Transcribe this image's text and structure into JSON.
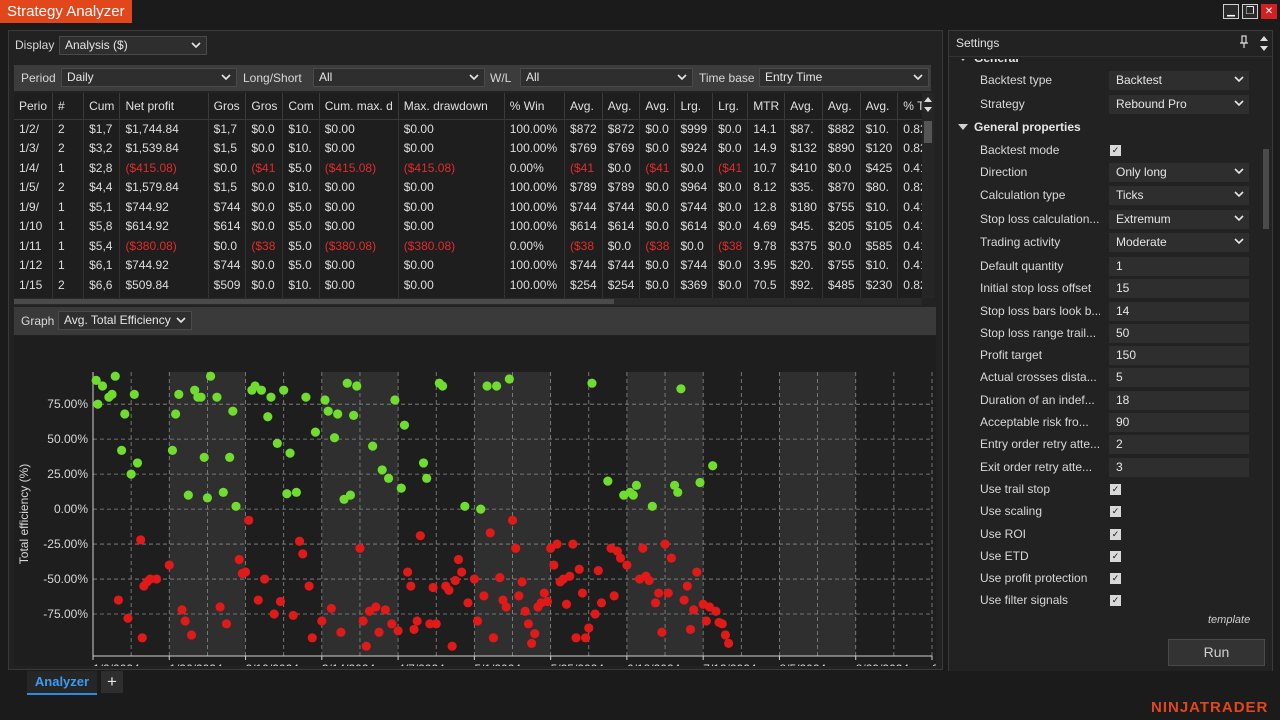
{
  "window": {
    "title": "Strategy Analyzer",
    "minimize": "▁",
    "restore": "❐",
    "close": "✕"
  },
  "display": {
    "label": "Display",
    "value": "Analysis ($)"
  },
  "filters": {
    "period_label": "Period",
    "period_value": "Daily",
    "longshort_label": "Long/Short",
    "longshort_value": "All",
    "wl_label": "W/L",
    "wl_value": "All",
    "timebase_label": "Time base",
    "timebase_value": "Entry Time"
  },
  "table": {
    "columns": [
      "Perio",
      "#",
      "Cum",
      "Net profit",
      "Gros",
      "Gros",
      "Com",
      "Cum. max. d",
      "Max. drawdown",
      "% Win",
      "Avg.",
      "Avg.",
      "Avg.",
      "Lrg. ",
      "Lrg.",
      "MTR",
      "Avg.",
      "Avg.",
      "Avg.",
      "% Tr"
    ],
    "rows": [
      [
        "1/2/",
        "2",
        "$1,7",
        "$1,744.84",
        "$1,7",
        "$0.0",
        "$10.",
        "$0.00",
        "$0.00",
        "100.00%",
        "$872",
        "$872",
        "$0.0",
        "$999",
        "$0.0",
        "14.1",
        "$87.",
        "$882",
        "$10.",
        "0.82"
      ],
      [
        "1/3/",
        "2",
        "$3,2",
        "$1,539.84",
        "$1,5",
        "$0.0",
        "$10.",
        "$0.00",
        "$0.00",
        "100.00%",
        "$769",
        "$769",
        "$0.0",
        "$924",
        "$0.0",
        "14.9",
        "$132",
        "$890",
        "$120",
        "0.82"
      ],
      [
        "1/4/",
        "1",
        "$2,8",
        "($415.08)",
        "$0.0",
        "($41",
        "$5.0",
        "($415.08)",
        "($415.08)",
        "0.00%",
        "($41",
        "$0.0",
        "($41",
        "$0.0",
        "($41",
        "10.7",
        "$410",
        "$0.0",
        "$425",
        "0.41"
      ],
      [
        "1/5/",
        "2",
        "$4,4",
        "$1,579.84",
        "$1,5",
        "$0.0",
        "$10.",
        "$0.00",
        "$0.00",
        "100.00%",
        "$789",
        "$789",
        "$0.0",
        "$964",
        "$0.0",
        "8.12",
        "$35.",
        "$870",
        "$80.",
        "0.82"
      ],
      [
        "1/9/",
        "1",
        "$5,1",
        "$744.92",
        "$744",
        "$0.0",
        "$5.0",
        "$0.00",
        "$0.00",
        "100.00%",
        "$744",
        "$744",
        "$0.0",
        "$744",
        "$0.0",
        "12.8",
        "$180",
        "$755",
        "$10.",
        "0.41"
      ],
      [
        "1/10",
        "1",
        "$5,8",
        "$614.92",
        "$614",
        "$0.0",
        "$5.0",
        "$0.00",
        "$0.00",
        "100.00%",
        "$614",
        "$614",
        "$0.0",
        "$614",
        "$0.0",
        "4.69",
        "$45.",
        "$205",
        "$105",
        "0.41"
      ],
      [
        "1/11",
        "1",
        "$5,4",
        "($380.08)",
        "$0.0",
        "($38",
        "$5.0",
        "($380.08)",
        "($380.08)",
        "0.00%",
        "($38",
        "$0.0",
        "($38",
        "$0.0",
        "($38",
        "9.78",
        "$375",
        "$0.0",
        "$585",
        "0.41"
      ],
      [
        "1/12",
        "1",
        "$6,1",
        "$744.92",
        "$744",
        "$0.0",
        "$5.0",
        "$0.00",
        "$0.00",
        "100.00%",
        "$744",
        "$744",
        "$0.0",
        "$744",
        "$0.0",
        "3.95",
        "$20.",
        "$755",
        "$10.",
        "0.41"
      ],
      [
        "1/15",
        "2",
        "$6,6",
        "$509.84",
        "$509",
        "$0.0",
        "$10.",
        "$0.00",
        "$0.00",
        "100.00%",
        "$254",
        "$254",
        "$0.0",
        "$369",
        "$0.0",
        "70.5",
        "$92.",
        "$485",
        "$230",
        "0.82"
      ],
      [
        "1/16",
        "2",
        "$7,4",
        "$744.92",
        "$744",
        "$0.0",
        "$5.0",
        "$0.00",
        "$0.00",
        "100.00%",
        "$744",
        "$744",
        "$0.0",
        "$744",
        "$0.0",
        "7.09",
        "$20.",
        "$755",
        "$10.",
        "0.82"
      ]
    ]
  },
  "graph": {
    "label": "Graph",
    "value": "Avg. Total Efficiency"
  },
  "chart_data": {
    "type": "scatter",
    "xlabel": "Date",
    "ylabel": "Total efficiency (%)",
    "ylim": [
      -105,
      98
    ],
    "y_ticks": [
      75,
      50,
      25,
      0,
      -25,
      -50,
      -75
    ],
    "y_tick_labels": [
      "75.00%",
      "50.00%",
      "25.00%",
      "0.00%",
      "-25.00%",
      "-50.00%",
      "-75.00%"
    ],
    "x_tick_labels": [
      "1/2/2024",
      "1/26/2024",
      "2/19/2024",
      "3/14/2024",
      "4/7/2024",
      "5/1/2024",
      "5/25/2024",
      "6/18/2024",
      "7/12/2024",
      "8/5/2024",
      "8/29/2024",
      "9/22/2024"
    ],
    "xlim": [
      0,
      264
    ],
    "shaded_bands": [
      [
        24,
        48
      ],
      [
        72,
        96
      ],
      [
        120,
        144
      ],
      [
        168,
        192
      ],
      [
        216,
        240
      ]
    ],
    "grid": true,
    "positive_color": "#6fdc2f",
    "negative_color": "#e01919",
    "points": [
      [
        1,
        92
      ],
      [
        1.5,
        75
      ],
      [
        3,
        88
      ],
      [
        5,
        80
      ],
      [
        6,
        82
      ],
      [
        7,
        95
      ],
      [
        8,
        -65
      ],
      [
        9,
        42
      ],
      [
        10,
        68
      ],
      [
        11,
        -78
      ],
      [
        12,
        25
      ],
      [
        13,
        82
      ],
      [
        14,
        33
      ],
      [
        15,
        -22
      ],
      [
        15.5,
        -92
      ],
      [
        16,
        -55
      ],
      [
        17,
        -52
      ],
      [
        18,
        -50
      ],
      [
        20,
        -50
      ],
      [
        24,
        -40
      ],
      [
        25,
        42
      ],
      [
        26,
        68
      ],
      [
        27,
        82
      ],
      [
        28,
        -72
      ],
      [
        29,
        -80
      ],
      [
        30,
        10
      ],
      [
        31,
        -90
      ],
      [
        32,
        85
      ],
      [
        33,
        80
      ],
      [
        34,
        80
      ],
      [
        35,
        37
      ],
      [
        36,
        8
      ],
      [
        37,
        95
      ],
      [
        39,
        80
      ],
      [
        40,
        -70
      ],
      [
        41,
        12
      ],
      [
        42,
        -82
      ],
      [
        43,
        37
      ],
      [
        44,
        70
      ],
      [
        45,
        2
      ],
      [
        46,
        -36
      ],
      [
        47,
        -46
      ],
      [
        48,
        -45
      ],
      [
        49,
        -8
      ],
      [
        50,
        85
      ],
      [
        51,
        88
      ],
      [
        52,
        -65
      ],
      [
        53,
        85
      ],
      [
        54,
        -50
      ],
      [
        55,
        66
      ],
      [
        56,
        80
      ],
      [
        57,
        -75
      ],
      [
        58,
        47
      ],
      [
        59,
        -66
      ],
      [
        60,
        85
      ],
      [
        61,
        11
      ],
      [
        62,
        40
      ],
      [
        63,
        -76
      ],
      [
        64,
        12
      ],
      [
        65,
        -23
      ],
      [
        66,
        -32
      ],
      [
        67,
        80
      ],
      [
        68,
        -55
      ],
      [
        69,
        -92
      ],
      [
        70,
        55
      ],
      [
        72,
        -80
      ],
      [
        73,
        78
      ],
      [
        74,
        70
      ],
      [
        75,
        -71
      ],
      [
        76,
        51
      ],
      [
        77,
        68
      ],
      [
        78,
        -88
      ],
      [
        79,
        7
      ],
      [
        80,
        90
      ],
      [
        81,
        10
      ],
      [
        82,
        67
      ],
      [
        83,
        88
      ],
      [
        84,
        -28
      ],
      [
        85,
        -80
      ],
      [
        86,
        -98
      ],
      [
        87,
        -73
      ],
      [
        88,
        45
      ],
      [
        89,
        -70
      ],
      [
        90,
        -88
      ],
      [
        91,
        28
      ],
      [
        92,
        -72
      ],
      [
        93,
        22
      ],
      [
        94,
        -82
      ],
      [
        95,
        78
      ],
      [
        96,
        -87
      ],
      [
        97,
        15
      ],
      [
        98,
        60
      ],
      [
        99,
        -45
      ],
      [
        100,
        -55
      ],
      [
        101,
        -86
      ],
      [
        102,
        -80
      ],
      [
        103,
        -19
      ],
      [
        104,
        33
      ],
      [
        105,
        22
      ],
      [
        106,
        -82
      ],
      [
        107,
        -56
      ],
      [
        108,
        -82
      ],
      [
        109,
        90
      ],
      [
        110,
        88
      ],
      [
        111,
        -55
      ],
      [
        112,
        -58
      ],
      [
        113,
        -98
      ],
      [
        114,
        -51
      ],
      [
        115,
        -36
      ],
      [
        116,
        -45
      ],
      [
        117,
        2
      ],
      [
        118,
        -67
      ],
      [
        120,
        -50
      ],
      [
        121,
        -80
      ],
      [
        122,
        0
      ],
      [
        123,
        -62
      ],
      [
        124,
        88
      ],
      [
        125,
        -17
      ],
      [
        126,
        -92
      ],
      [
        127,
        88
      ],
      [
        128,
        -49
      ],
      [
        129,
        -65
      ],
      [
        130,
        -70
      ],
      [
        131,
        93
      ],
      [
        132,
        -8
      ],
      [
        133,
        -28
      ],
      [
        134,
        -62
      ],
      [
        135,
        -52
      ],
      [
        136,
        -73
      ],
      [
        137,
        -82
      ],
      [
        138,
        -96
      ],
      [
        139,
        -89
      ],
      [
        140,
        -70
      ],
      [
        141,
        -67
      ],
      [
        142,
        -60
      ],
      [
        143,
        -66
      ],
      [
        144,
        -28
      ],
      [
        145,
        -40
      ],
      [
        146,
        -25
      ],
      [
        147,
        -52
      ],
      [
        148,
        -50
      ],
      [
        149,
        -68
      ],
      [
        150,
        -48
      ],
      [
        151,
        -25
      ],
      [
        152,
        -92
      ],
      [
        153,
        -43
      ],
      [
        154,
        -60
      ],
      [
        155,
        -92
      ],
      [
        156,
        -85
      ],
      [
        157,
        90
      ],
      [
        158,
        -75
      ],
      [
        159,
        -44
      ],
      [
        160,
        -67
      ],
      [
        162,
        20
      ],
      [
        163,
        -28
      ],
      [
        164,
        -62
      ],
      [
        165,
        -30
      ],
      [
        166,
        -35
      ],
      [
        167,
        10
      ],
      [
        168,
        -40
      ],
      [
        169,
        12
      ],
      [
        170,
        10
      ],
      [
        171,
        17
      ],
      [
        172,
        -50
      ],
      [
        173,
        -28
      ],
      [
        174,
        -48
      ],
      [
        175,
        -51
      ],
      [
        176,
        2
      ],
      [
        177,
        -67
      ],
      [
        178,
        -60
      ],
      [
        179,
        -88
      ],
      [
        180,
        -25
      ],
      [
        181,
        -60
      ],
      [
        182,
        -35
      ],
      [
        183,
        17
      ],
      [
        184,
        12
      ],
      [
        185,
        86
      ],
      [
        186,
        -65
      ],
      [
        187,
        -55
      ],
      [
        188,
        -86
      ],
      [
        189,
        -72
      ],
      [
        190,
        -45
      ],
      [
        191,
        19
      ],
      [
        192,
        -68
      ],
      [
        193,
        -80
      ],
      [
        194,
        -70
      ],
      [
        195,
        31
      ],
      [
        196,
        -73
      ],
      [
        197,
        -81
      ],
      [
        198,
        -82
      ],
      [
        199,
        -90
      ],
      [
        200,
        -96
      ]
    ]
  },
  "settings": {
    "title": "Settings",
    "pin": "📌",
    "rows": [
      {
        "type": "cat",
        "name": "General",
        "top": -12
      },
      {
        "type": "combo",
        "name": "Backtest type",
        "value": "Backtest"
      },
      {
        "type": "combo",
        "name": "Strategy",
        "value": "Rebound Pro"
      },
      {
        "type": "cat",
        "name": "General properties"
      },
      {
        "type": "check",
        "name": "Backtest mode"
      },
      {
        "type": "combo",
        "name": "Direction",
        "value": "Only long"
      },
      {
        "type": "combo",
        "name": "Calculation type",
        "value": "Ticks"
      },
      {
        "type": "combo",
        "name": "Stop loss calculation...",
        "value": "Extremum"
      },
      {
        "type": "combo",
        "name": "Trading activity",
        "value": "Moderate"
      },
      {
        "type": "text",
        "name": "Default quantity",
        "value": "1"
      },
      {
        "type": "text",
        "name": "Initial stop loss offset",
        "value": "15"
      },
      {
        "type": "text",
        "name": "Stop loss bars look b...",
        "value": "14"
      },
      {
        "type": "text",
        "name": "Stop loss range trail...",
        "value": "50"
      },
      {
        "type": "text",
        "name": "Profit target",
        "value": "150"
      },
      {
        "type": "text",
        "name": "Actual crosses dista...",
        "value": "5"
      },
      {
        "type": "text",
        "name": "Duration of an indef...",
        "value": "18"
      },
      {
        "type": "text",
        "name": "Acceptable risk fro...",
        "value": "90"
      },
      {
        "type": "text",
        "name": "Entry order retry atte...",
        "value": "2"
      },
      {
        "type": "text",
        "name": "Exit order retry atte...",
        "value": "3"
      },
      {
        "type": "check",
        "name": "Use trail stop"
      },
      {
        "type": "check",
        "name": "Use scaling"
      },
      {
        "type": "check",
        "name": "Use ROI"
      },
      {
        "type": "check",
        "name": "Use ETD"
      },
      {
        "type": "check",
        "name": "Use profit protection"
      },
      {
        "type": "check",
        "name": "Use filter signals"
      }
    ],
    "template_label": "template",
    "run_label": "Run"
  },
  "tabs": {
    "active": "Analyzer",
    "add": "+"
  },
  "brand": "NINJATRADER"
}
